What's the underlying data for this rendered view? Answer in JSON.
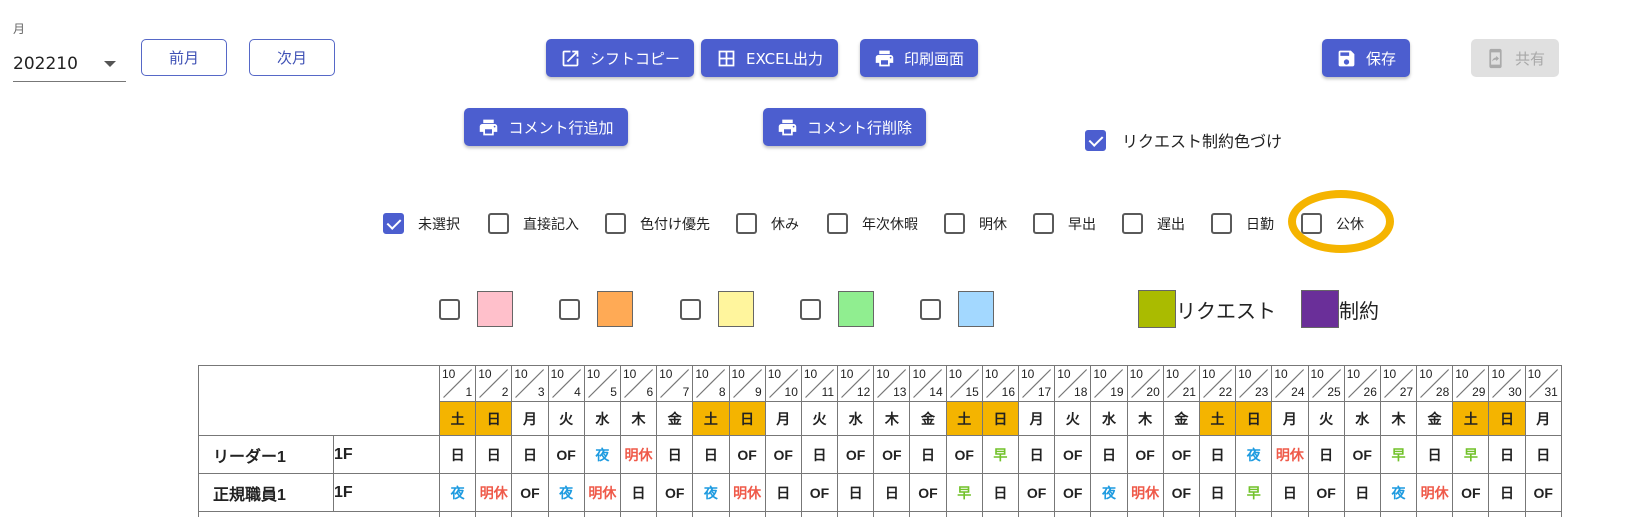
{
  "header": {
    "month_label": "月",
    "month_value": "202210",
    "prev_month": "前月",
    "next_month": "次月",
    "shift_copy": "シフトコピー",
    "excel_export": "EXCEL出力",
    "print_screen": "印刷画面",
    "save": "保存",
    "share": "共有",
    "add_comment_row": "コメント行追加",
    "delete_comment_row": "コメント行削除",
    "request_color": "リクエスト制約色づけ"
  },
  "filters": [
    {
      "label": "未選択",
      "checked": true
    },
    {
      "label": "直接記入",
      "checked": false
    },
    {
      "label": "色付け優先",
      "checked": false
    },
    {
      "label": "休み",
      "checked": false
    },
    {
      "label": "年次休暇",
      "checked": false
    },
    {
      "label": "明休",
      "checked": false
    },
    {
      "label": "早出",
      "checked": false
    },
    {
      "label": "遅出",
      "checked": false
    },
    {
      "label": "日勤",
      "checked": false
    },
    {
      "label": "公休",
      "checked": false,
      "highlighted": true
    }
  ],
  "color_options": [
    {
      "color": "#ffc0cb",
      "checked": false
    },
    {
      "color": "#ffaa55",
      "checked": false
    },
    {
      "color": "#fff59d",
      "checked": false
    },
    {
      "color": "#90ee90",
      "checked": false
    },
    {
      "color": "#a3d8ff",
      "checked": false
    }
  ],
  "legend": [
    {
      "label": "リクエスト",
      "color": "#aabb00"
    },
    {
      "label": "制約",
      "color": "#6a2f99"
    }
  ],
  "table": {
    "month": "10",
    "days": [
      "1",
      "2",
      "3",
      "4",
      "5",
      "6",
      "7",
      "8",
      "9",
      "10",
      "11",
      "12",
      "13",
      "14",
      "15",
      "16",
      "17",
      "18",
      "19",
      "20",
      "21",
      "22",
      "23",
      "24",
      "25",
      "26",
      "27",
      "28",
      "29",
      "30",
      "31"
    ],
    "weekdays": [
      "土",
      "日",
      "月",
      "火",
      "水",
      "木",
      "金",
      "土",
      "日",
      "月",
      "火",
      "水",
      "木",
      "金",
      "土",
      "日",
      "月",
      "火",
      "水",
      "木",
      "金",
      "土",
      "日",
      "月",
      "火",
      "水",
      "木",
      "金",
      "土",
      "日",
      "月"
    ],
    "weekend_color": "#f4b400",
    "rows": [
      {
        "name": "リーダー1",
        "floor": "1F",
        "cells": [
          "日",
          "日",
          "日",
          "OF",
          "夜",
          "明休",
          "日",
          "日",
          "OF",
          "OF",
          "日",
          "OF",
          "OF",
          "日",
          "OF",
          "早",
          "日",
          "OF",
          "日",
          "OF",
          "OF",
          "日",
          "夜",
          "明休",
          "日",
          "OF",
          "早",
          "日",
          "早",
          "日",
          "日"
        ]
      },
      {
        "name": "正規職員1",
        "floor": "1F",
        "cells": [
          "夜",
          "明休",
          "OF",
          "夜",
          "明休",
          "日",
          "OF",
          "夜",
          "明休",
          "日",
          "OF",
          "日",
          "日",
          "OF",
          "早",
          "日",
          "OF",
          "OF",
          "夜",
          "明休",
          "OF",
          "日",
          "早",
          "日",
          "OF",
          "日",
          "夜",
          "明休",
          "OF",
          "日",
          "OF"
        ]
      }
    ],
    "code_colors": {
      "夜": "#1e9be0",
      "明休": "#ef5a4a",
      "早": "#72c22b"
    }
  }
}
